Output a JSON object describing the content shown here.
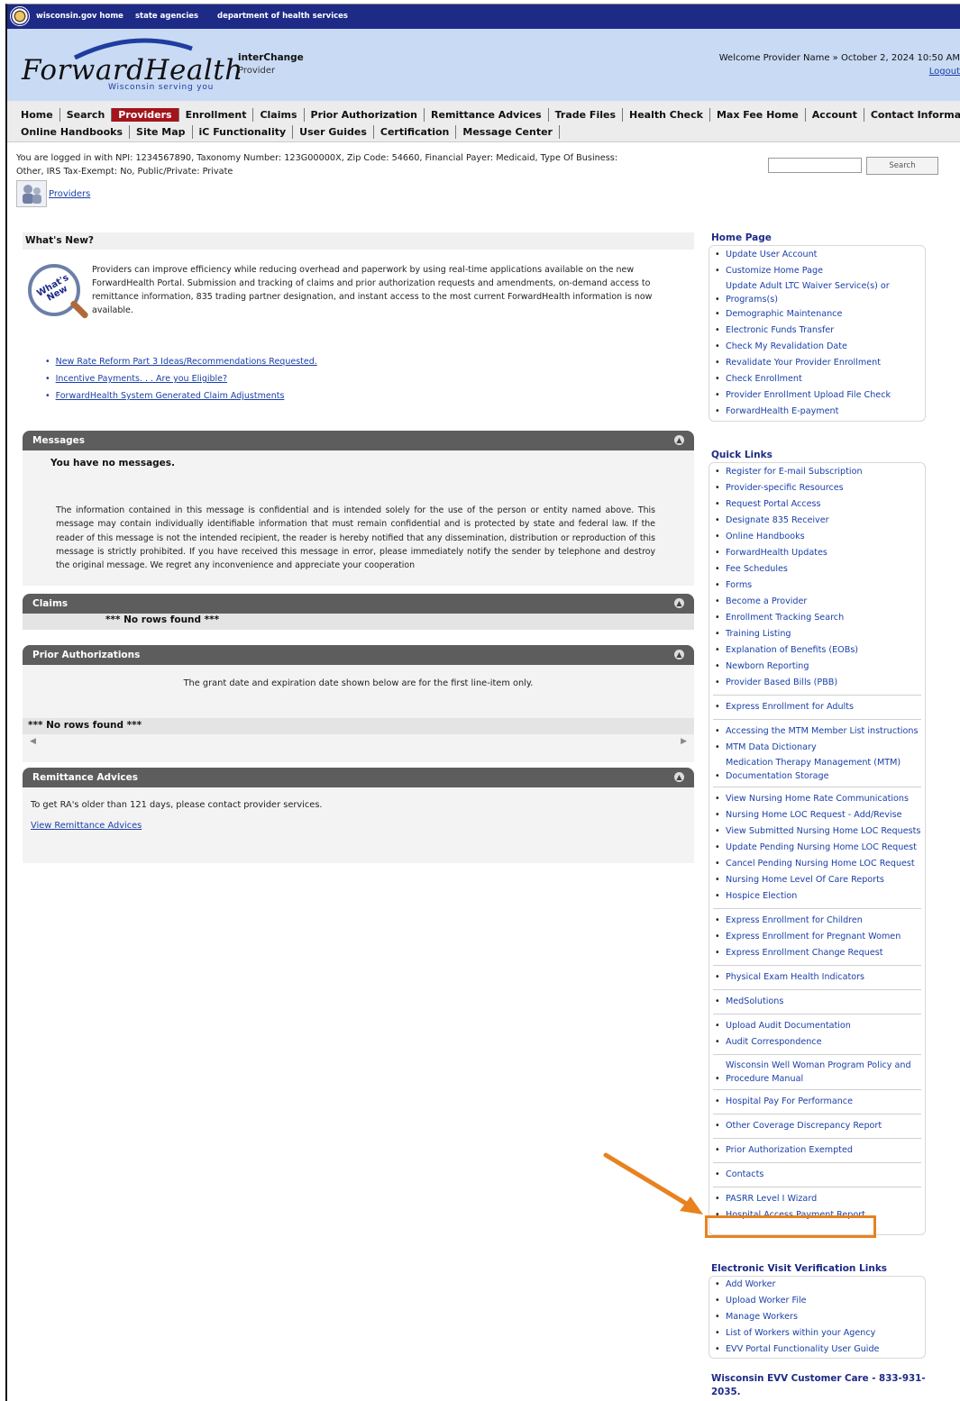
{
  "state_bar": {
    "links": [
      "wisconsin.gov home",
      "state agencies",
      "department of health services"
    ]
  },
  "header": {
    "logo_text": "ForwardHealth",
    "logo_tagline": "Wisconsin serving you",
    "app_name": "interChange",
    "app_subtitle": "Provider",
    "welcome": "Welcome Provider Name » October 2, 2024 10:50 AM",
    "logout": "Logout"
  },
  "nav": {
    "row1": [
      "Home",
      "Search",
      "Providers",
      "Enrollment",
      "Claims",
      "Prior Authorization",
      "Remittance Advices",
      "Trade Files",
      "Health Check",
      "Max Fee Home",
      "Account",
      "Contact Information"
    ],
    "row2": [
      "Online Handbooks",
      "Site Map",
      "iC Functionality",
      "User Guides",
      "Certification",
      "Message Center"
    ],
    "active": "Providers"
  },
  "login_info": "You are logged in with NPI: 1234567890, Taxonomy Number: 123G00000X, Zip Code: 54660, Financial Payer: Medicaid, Type Of Business: Other, IRS Tax-Exempt: No, Public/Private: Private",
  "search": {
    "value": "",
    "button": "Search"
  },
  "breadcrumb_link": "Providers",
  "whats_new": {
    "title": "What's New?",
    "icon_text": "What's New",
    "body": "Providers can improve efficiency while reducing overhead and paperwork by using real-time applications available on the new ForwardHealth Portal. Submission and tracking of claims and prior authorization requests and amendments, on-demand access to remittance information, 835 trading partner designation, and instant access to the most current ForwardHealth information is now available.",
    "links": [
      "New Rate Reform Part 3 Ideas/Recommendations Requested.",
      "Incentive Payments. . . Are you Eligible?",
      "ForwardHealth System Generated Claim Adjustments"
    ]
  },
  "messages": {
    "title": "Messages",
    "none": "You have no messages.",
    "confidential": "The information contained in this message is confidential and is intended solely for the use of the person or entity named above. This message may contain individually identifiable information that must remain confidential and is protected by state and federal law. If the reader of this message is not the intended recipient, the reader is hereby notified that any dissemination, distribution or reproduction of this message is strictly prohibited. If you have received this message in error, please immediately notify the sender by telephone and destroy the original message. We regret any inconvenience and appreciate your cooperation"
  },
  "claims": {
    "title": "Claims",
    "no_rows": "*** No rows found ***"
  },
  "prior_auth": {
    "title": "Prior Authorizations",
    "note": "The grant date and expiration date shown below are for the first line-item only.",
    "no_rows": "*** No rows found ***"
  },
  "remittance": {
    "title": "Remittance Advices",
    "text": "To get RA's older than 121 days, please contact provider services.",
    "link": "View Remittance Advices"
  },
  "home_page": {
    "title": "Home Page",
    "items": [
      "Update User Account",
      "Customize Home Page",
      "Update Adult LTC Waiver Service(s) or Programs(s)",
      "Demographic Maintenance",
      "Electronic Funds Transfer",
      "Check My Revalidation Date",
      "Revalidate Your Provider Enrollment",
      "Check Enrollment",
      "Provider Enrollment Upload File Check",
      "ForwardHealth E-payment"
    ]
  },
  "quick_links": {
    "title": "Quick Links",
    "items": [
      "Register for E-mail Subscription",
      "Provider-specific Resources",
      "Request Portal Access",
      "Designate 835 Receiver",
      "Online Handbooks",
      "ForwardHealth Updates",
      "Fee Schedules",
      "Forms",
      "Become a Provider",
      "Enrollment Tracking Search",
      "Training Listing",
      "Explanation of Benefits (EOBs)",
      "Newborn Reporting",
      "Provider Based Bills (PBB)",
      "Express Enrollment for Adults",
      "Accessing the MTM Member List instructions",
      "MTM Data Dictionary",
      "Medication Therapy Management (MTM) Documentation Storage",
      "View Nursing Home Rate Communications",
      "Nursing Home LOC Request - Add/Revise",
      "View Submitted Nursing Home LOC Requests",
      "Update Pending Nursing Home LOC Request",
      "Cancel Pending Nursing Home LOC Request",
      "Nursing Home Level Of Care Reports",
      "Hospice Election",
      "Express Enrollment for Children",
      "Express Enrollment for Pregnant Women",
      "Express Enrollment Change Request",
      "Physical Exam Health Indicators",
      "MedSolutions",
      "Upload Audit Documentation",
      "Audit Correspondence",
      "Wisconsin Well Woman Program Policy and Procedure Manual",
      "Hospital Pay For Performance",
      "Other Coverage Discrepancy Report",
      "Prior Authorization Exempted",
      "Contacts",
      "PASRR Level I Wizard",
      "Hospital Access Payment Report"
    ],
    "highlighted": "Hospital Access Payment Report"
  },
  "evv": {
    "title": "Electronic Visit Verification Links",
    "items": [
      "Add Worker",
      "Upload Worker File",
      "Manage Workers",
      "List of Workers within your Agency",
      "EVV Portal Functionality User Guide"
    ],
    "customer_care": "Wisconsin EVV Customer Care - 833-931-2035."
  },
  "colors": {
    "state_bar": "#1d2a86",
    "header": "#c9daf4",
    "active_tab": "#a3141c",
    "portlet_head": "#5d5d5d",
    "highlight": "#e8821e"
  }
}
